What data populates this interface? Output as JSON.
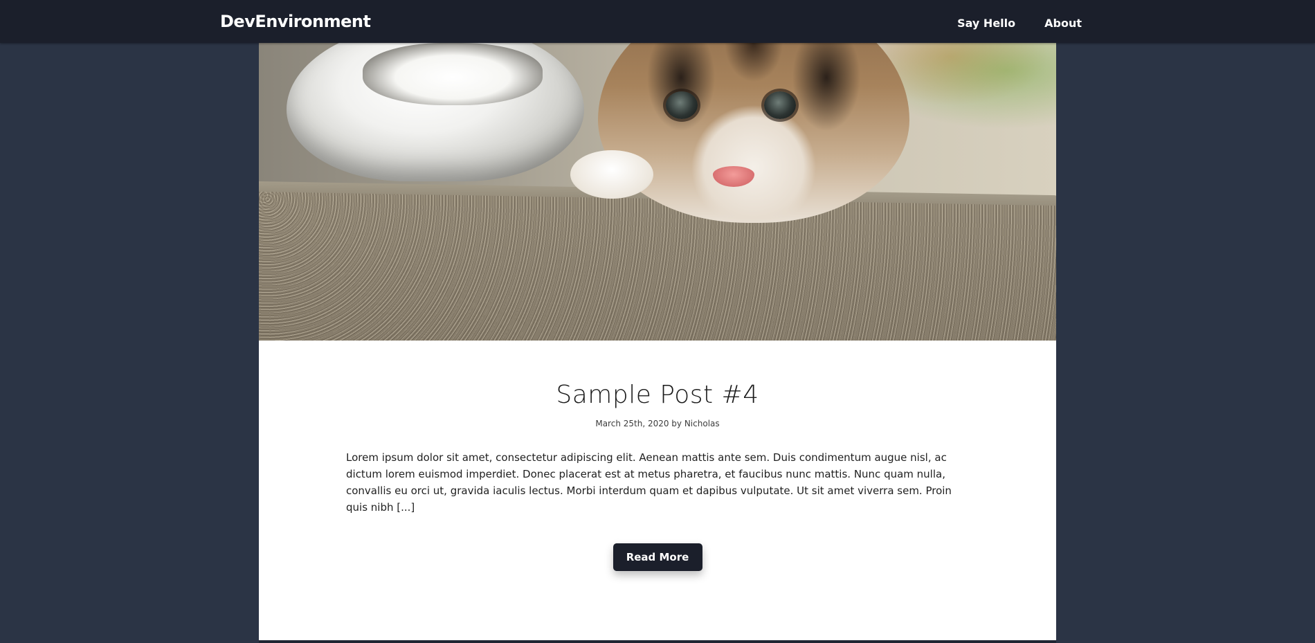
{
  "navbar": {
    "brand": "DevEnvironment",
    "links": [
      {
        "label": "Say Hello"
      },
      {
        "label": "About"
      }
    ]
  },
  "post": {
    "title": "Sample Post #4",
    "meta": "March 25th, 2020 by Nicholas",
    "excerpt": "Lorem ipsum dolor sit amet, consectetur adipiscing elit. Aenean mattis ante sem. Duis condimentum augue nisl, ac dictum lorem euismod imperdiet. Donec placerat est at metus pharetra, et faucibus nunc mattis. Nunc quam nulla, convallis eu orci ut, gravida iaculis lectus. Morbi interdum quam et dapibus vulputate. Ut sit amet viverra sem. Proin quis nibh [...]",
    "read_more_label": "Read More"
  },
  "colors": {
    "page_background": "#2b3445",
    "navbar_background": "#1b1f2b",
    "card_background": "#ffffff",
    "button_background": "#1b1f2b"
  }
}
